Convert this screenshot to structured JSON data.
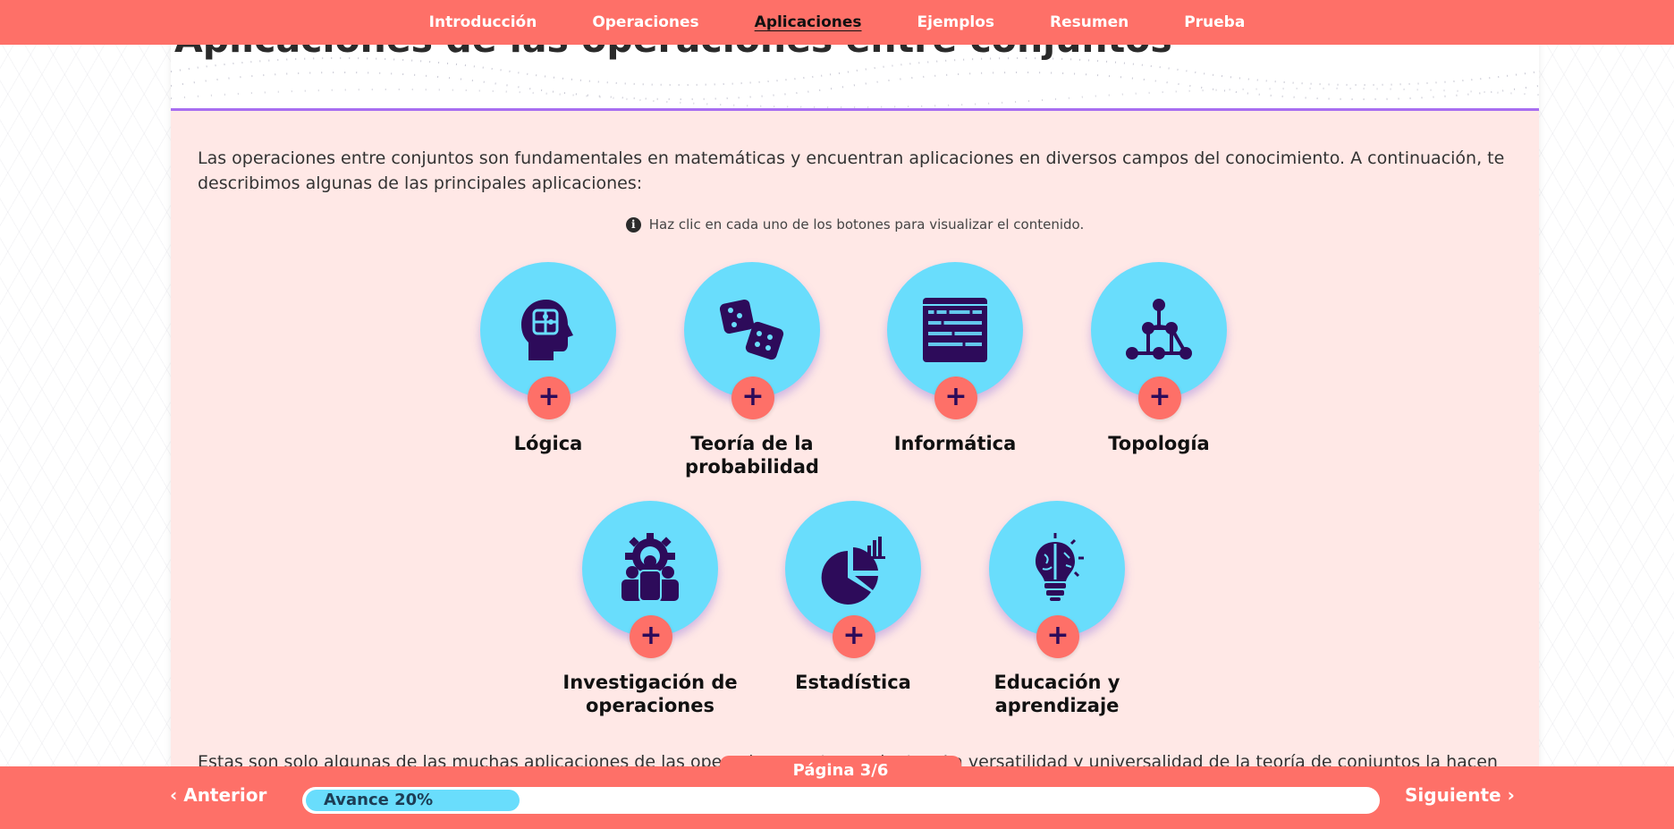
{
  "nav": {
    "items": [
      {
        "label": "Introducción",
        "active": false
      },
      {
        "label": "Operaciones",
        "active": false
      },
      {
        "label": "Aplicaciones",
        "active": true
      },
      {
        "label": "Ejemplos",
        "active": false
      },
      {
        "label": "Resumen",
        "active": false
      },
      {
        "label": "Prueba",
        "active": false
      }
    ]
  },
  "header": {
    "title": "Aplicaciones de las operaciones entre conjuntos"
  },
  "content": {
    "intro": "Las operaciones entre conjuntos son fundamentales en matemáticas y encuentran aplicaciones en diversos campos del conocimiento. A continuación, te describimos algunas de las principales aplicaciones:",
    "hint": "Haz clic en cada uno de los botones para visualizar el contenido.",
    "outro": "Estas son solo algunas de las muchas aplicaciones de las operaciones entre conjuntos. La versatilidad y universalidad de la teoría de conjuntos la hacen"
  },
  "cards": [
    {
      "label": "Lógica",
      "icon": "head-puzzle-icon"
    },
    {
      "label": "Teoría de la probabilidad",
      "icon": "dice-icon"
    },
    {
      "label": "Informática",
      "icon": "binary-code-icon"
    },
    {
      "label": "Topología",
      "icon": "network-nodes-icon"
    },
    {
      "label": "Investigación de operaciones",
      "icon": "gear-team-icon"
    },
    {
      "label": "Estadística",
      "icon": "pie-chart-icon"
    },
    {
      "label": "Educación y aprendizaje",
      "icon": "lightbulb-brain-icon"
    }
  ],
  "plus_symbol": "+",
  "footer": {
    "page_indicator": "Página 3/6",
    "prev_label": "Anterior",
    "next_label": "Siguiente",
    "progress_label": "Avance 20%",
    "progress_fraction": 0.2
  },
  "colors": {
    "brand": "#fe7068",
    "icon_bg": "#69ddfc",
    "icon_fg": "#2d0b5a",
    "accent_line": "#a86ef0",
    "body_bg": "#ffe8e6"
  }
}
